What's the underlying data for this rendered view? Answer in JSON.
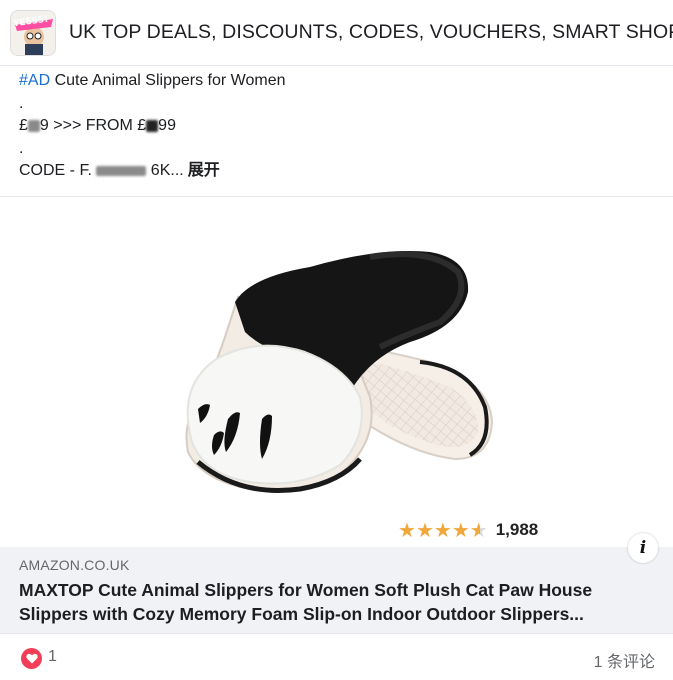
{
  "group": {
    "title": "UK TOP DEALS, DISCOUNTS, CODES, VOUCHERS, SMART SHOPPE",
    "avatar_text": "YESSS!"
  },
  "post": {
    "hashtag": "#AD",
    "headline": "Cute Animal Slippers for Women",
    "dot1": ".",
    "price_prefix": "£",
    "price_mid": "9 >>> FROM £",
    "price_end": "99",
    "dot2": ".",
    "code_prefix": "CODE - F.",
    "code_end": "6K...",
    "see_more": "展开"
  },
  "product": {
    "rating_stars": 4.5,
    "rating_count": "1,988"
  },
  "link_preview": {
    "domain": "AMAZON.CO.UK",
    "title": "MAXTOP Cute Animal Slippers for Women Soft Plush Cat Paw House Slippers with Cozy Memory Foam Slip-on Indoor Outdoor Slippers...",
    "info_label": "i"
  },
  "footer": {
    "reaction_count": "1",
    "comments": "1 条评论"
  },
  "colors": {
    "hashtag": "#1a6fd1",
    "star": "#f0a73b",
    "reaction": "#f33e58",
    "link_bg": "#f0f2f5"
  }
}
